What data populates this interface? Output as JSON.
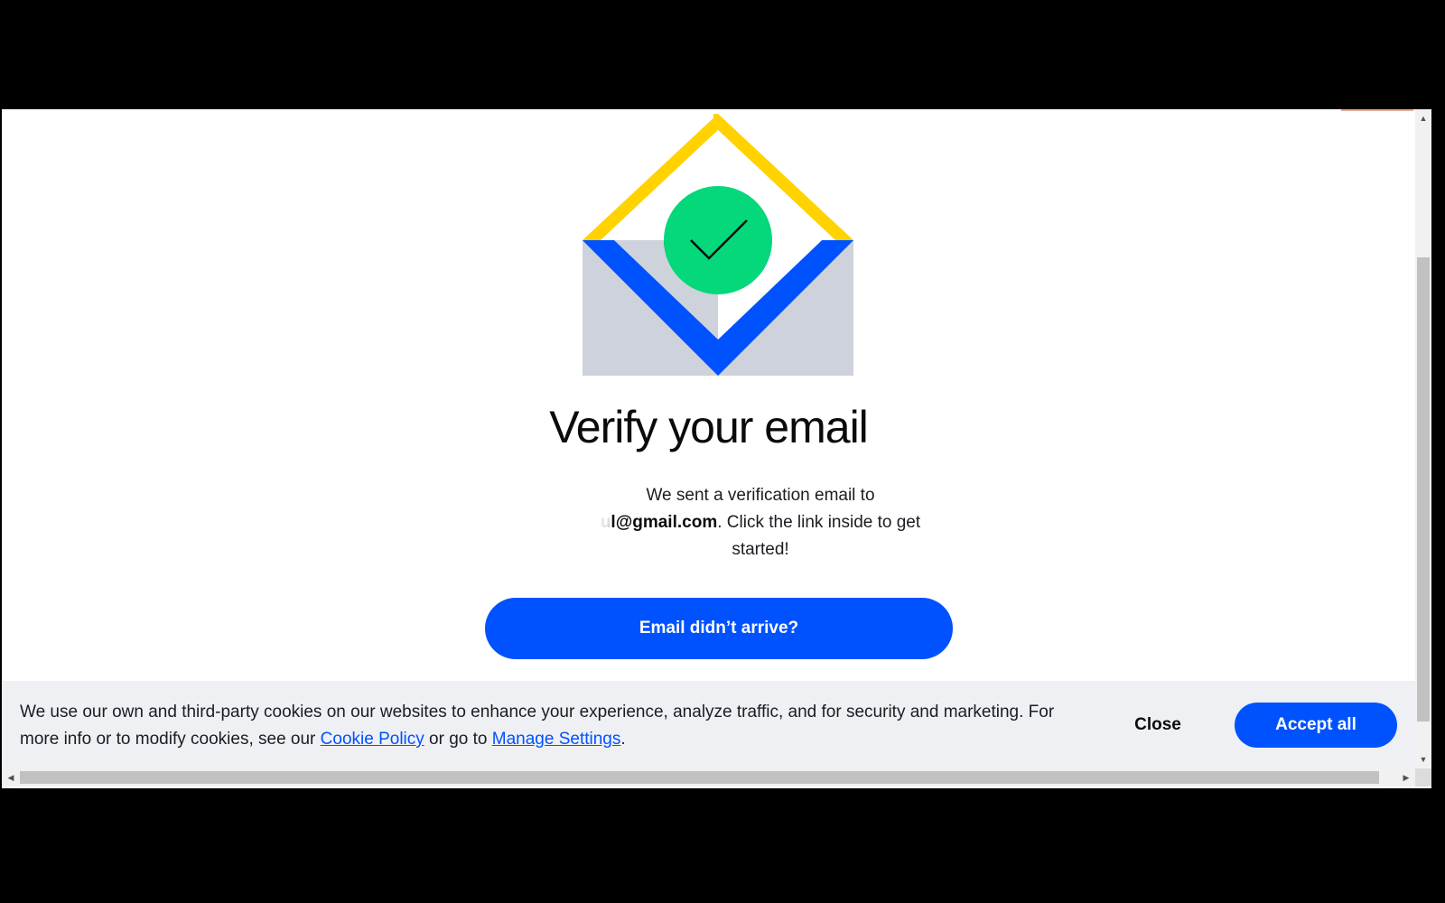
{
  "page": {
    "title": "Verify your email",
    "message_before": "We sent a verification email to",
    "email_partial": "ul@gmail.com",
    "message_after": ". Click the link inside to get started!",
    "primary_button": "Email didn’t arrive?"
  },
  "illustration": {
    "icon": "envelope-check-icon",
    "colors": {
      "flap": "#ffd200",
      "envelope_blue": "#0052ff",
      "envelope_gray": "#ced2db",
      "check_circle": "#05d87b",
      "check_shadow": "#0a0b0d"
    }
  },
  "cookie_banner": {
    "text_before": "We use our own and third-party cookies on our websites to enhance your experience, analyze traffic, and for security and marketing. For more info or to modify cookies, see our ",
    "cookie_policy_link": "Cookie Policy",
    "text_middle": " or go to ",
    "manage_settings_link": "Manage Settings",
    "text_after": ".",
    "close_label": "Close",
    "accept_label": "Accept all"
  },
  "scrollbars": {
    "up": "▲",
    "down": "▼",
    "left": "◀",
    "right": "▶"
  },
  "colors": {
    "accent": "#0052ff",
    "banner_bg": "#eef0f3",
    "text": "#0a0b0d"
  }
}
